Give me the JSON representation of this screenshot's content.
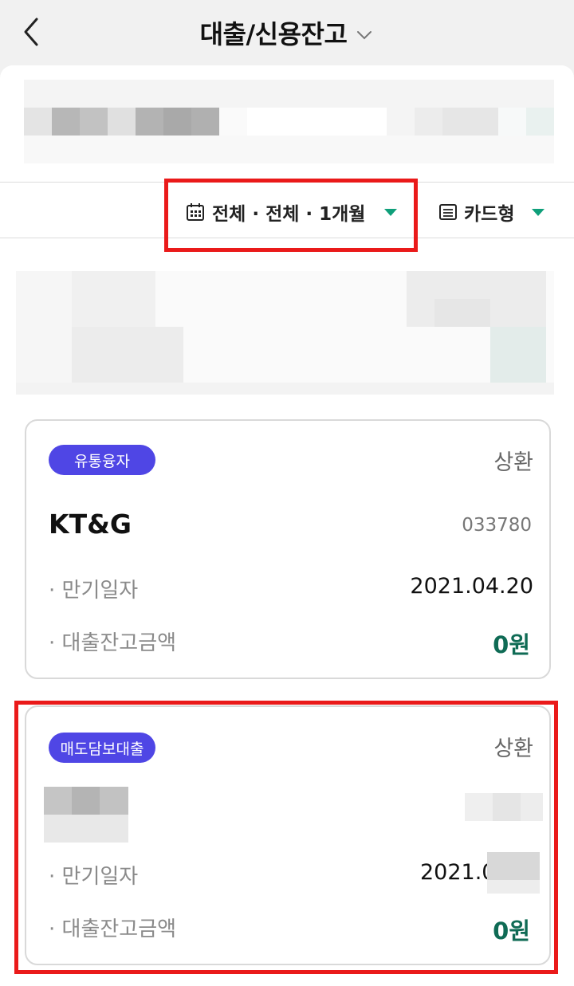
{
  "header": {
    "title": "대출/신용잔고"
  },
  "filter": {
    "period_label": "전체 · 전체 · 1개월",
    "view_label": "카드형"
  },
  "cards": [
    {
      "badge": "유통융자",
      "status": "상환",
      "name": "KT&G",
      "code": "033780",
      "due_label": "· 만기일자",
      "due_value": "2021.04.20",
      "balance_label": "· 대출잔고금액",
      "balance_value": "0원"
    },
    {
      "badge": "매도담보대출",
      "status": "상환",
      "due_label": "· 만기일자",
      "due_value": "2021.0",
      "balance_label": "· 대출잔고금액",
      "balance_value": "0원"
    }
  ],
  "colors": {
    "accent": "#0f9f7a",
    "badge": "#4f46e5",
    "amount": "#0f6b55",
    "highlight": "#ea1a1a"
  }
}
